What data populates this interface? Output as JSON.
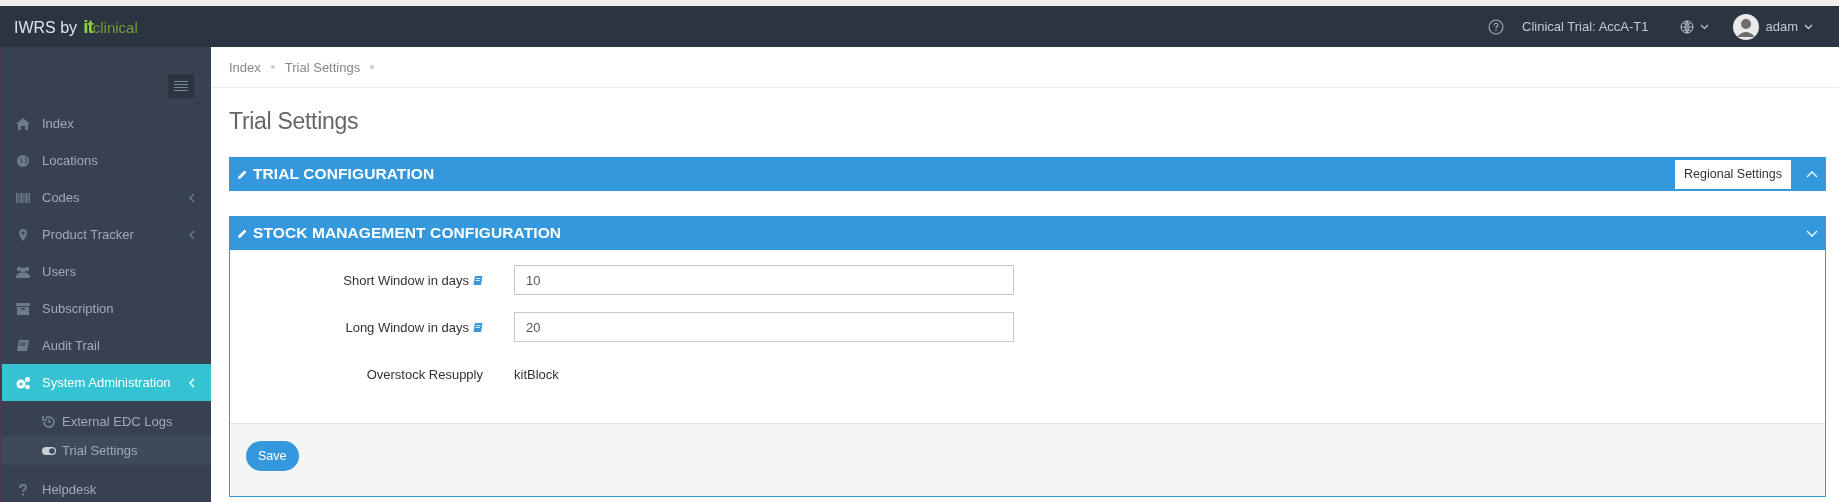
{
  "header": {
    "logo": {
      "text": "IWRS by",
      "brand_mark": "it",
      "brand_name": "clinical"
    },
    "trial": "Clinical Trial: AccA-T1",
    "user": "adam"
  },
  "sidebar": {
    "items": [
      {
        "label": "Index",
        "has_submenu": false,
        "selected": false
      },
      {
        "label": "Locations",
        "has_submenu": false,
        "selected": false
      },
      {
        "label": "Codes",
        "has_submenu": true,
        "selected": false
      },
      {
        "label": "Product Tracker",
        "has_submenu": true,
        "selected": false
      },
      {
        "label": "Users",
        "has_submenu": false,
        "selected": false
      },
      {
        "label": "Subscription",
        "has_submenu": false,
        "selected": false
      },
      {
        "label": "Audit Trail",
        "has_submenu": false,
        "selected": false
      },
      {
        "label": "System Administration",
        "has_submenu": true,
        "selected": true,
        "children": [
          {
            "label": "External EDC Logs",
            "selected": false
          },
          {
            "label": "Trial Settings",
            "selected": true
          }
        ]
      },
      {
        "label": "Helpdesk",
        "has_submenu": false,
        "selected": false
      }
    ]
  },
  "breadcrumb": [
    "Index",
    "Trial Settings"
  ],
  "page_title": "Trial Settings",
  "panels": [
    {
      "title": "TRIAL CONFIGURATION",
      "expanded": false,
      "action": "Regional Settings"
    },
    {
      "title": "STOCK MANAGEMENT CONFIGURATION",
      "expanded": true,
      "fields": [
        {
          "kind": "input",
          "label": "Short Window in days",
          "value": "10",
          "help": true
        },
        {
          "kind": "input",
          "label": "Long Window in days",
          "value": "20",
          "help": true
        },
        {
          "kind": "static",
          "label": "Overstock Resupply",
          "value": "kitBlock",
          "help": false
        }
      ],
      "button": "Save"
    }
  ]
}
